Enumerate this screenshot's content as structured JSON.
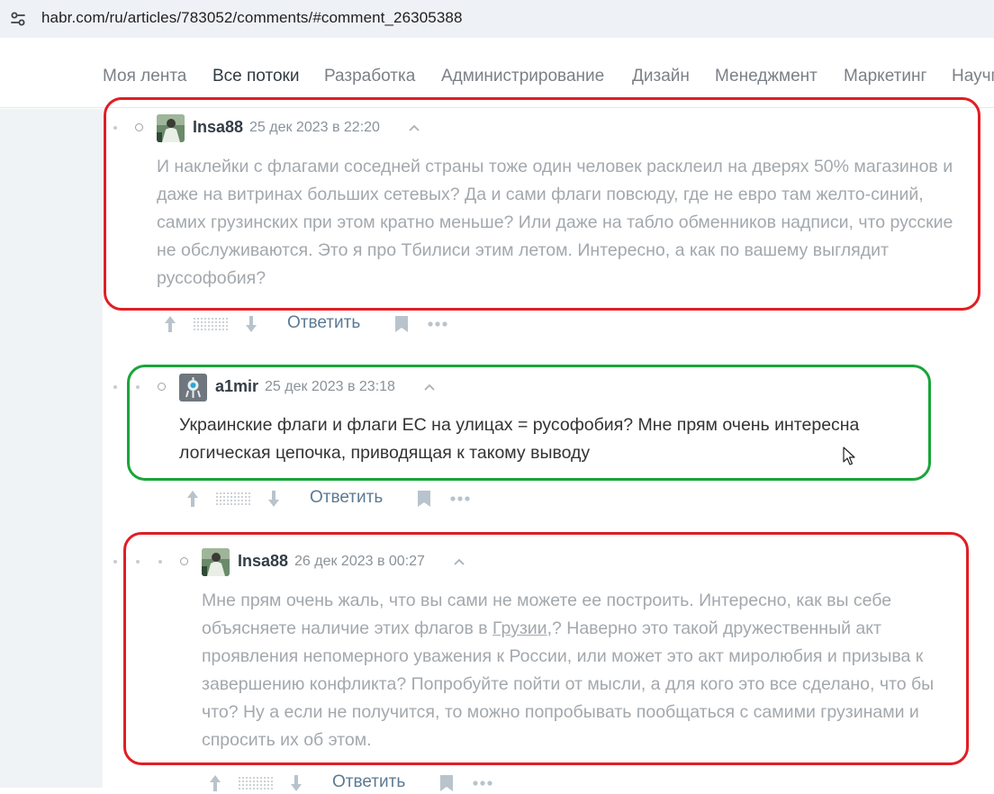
{
  "address_bar": {
    "url": "habr.com/ru/articles/783052/comments/#comment_26305388",
    "site_settings_icon": "tune-icon"
  },
  "nav": {
    "items": [
      {
        "label": "Моя лента",
        "active": false
      },
      {
        "label": "Все потоки",
        "active": true
      },
      {
        "label": "Разработка",
        "active": false
      },
      {
        "label": "Администрирование",
        "active": false
      },
      {
        "label": "Дизайн",
        "active": false
      },
      {
        "label": "Менеджмент",
        "active": false
      },
      {
        "label": "Маркетинг",
        "active": false
      },
      {
        "label": "Научпоп",
        "active": false
      }
    ]
  },
  "comments": [
    {
      "author": "Insa88",
      "date": "25 дек 2023 в 22:20",
      "body": "И наклейки с флагами соседней страны тоже один человек расклеил на дверях 50% магазинов и даже на витринах больших сетевых? Да и сами флаги повсюду, где не евро там желто-синий, самих грузинских при этом кратно меньше? Или даже на табло обменников надписи, что русские не обслуживаются. Это я про Тбилиси этим летом. Интересно, а как по вашему выглядит руссофобия?",
      "faded": true,
      "frame": "red",
      "reply_label": "Ответить"
    },
    {
      "author": "a1mir",
      "date": "25 дек 2023 в 23:18",
      "body": "Украинские флаги и флаги ЕС на улицах = русофобия? Мне прям очень интересна логическая цепочка, приводящая к такому выводу",
      "faded": false,
      "frame": "green",
      "reply_label": "Ответить"
    },
    {
      "author": "Insa88",
      "date": "26 дек 2023 в 00:27",
      "body_before_link": "Мне прям очень жаль, что вы сами не можете ее построить. Интересно, как вы себе объясняете наличие этих флагов в ",
      "body_link": "Грузии",
      "body_after_link": ",? Наверно это такой дружественный акт проявления непомерного уважения к России, или может это акт миролюбия и призыва к завершению конфликта? Попробуйте пойти от мысли, а для кого это все сделано, что бы что? Ну а если не получится, то можно попробывать пообщаться с самими грузинами и спросить их об этом.",
      "faded": true,
      "frame": "red",
      "reply_label": "Ответить"
    }
  ],
  "colors": {
    "frame_red": "#e01e24",
    "frame_green": "#19a53a",
    "reply_link": "#5b7a93",
    "faded_text": "#a3a8ad"
  }
}
